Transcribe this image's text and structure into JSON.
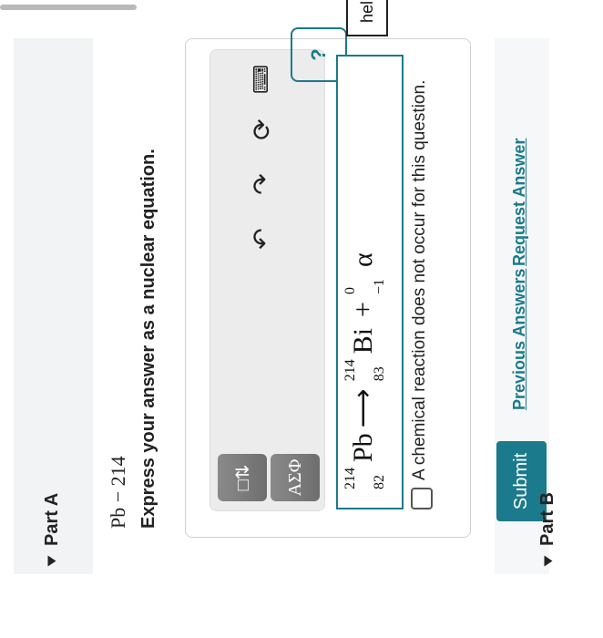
{
  "part_a": {
    "label": "Part A"
  },
  "part_b": {
    "label": "Part B"
  },
  "isotope": "Pb − 214",
  "prompt": "Express your answer as a nuclear equation.",
  "toolbar": {
    "templates_button": "□⇅",
    "symbols_button": "ΑΣΦ",
    "help_button": "?",
    "help_tag": "help"
  },
  "equation": {
    "reactant": {
      "mass": "214",
      "atomic": "82",
      "symbol": "Pb"
    },
    "arrow": "⟶",
    "product1": {
      "mass": "214",
      "atomic": "83",
      "symbol": "Bi"
    },
    "plus": "+",
    "product2": {
      "mass": "0",
      "atomic": "−1",
      "symbol": "α"
    }
  },
  "no_reaction_text": "A chemical reaction does not occur for this question.",
  "actions": {
    "submit": "Submit",
    "previous_answers": "Previous Answers",
    "request_answer": "Request Answer"
  }
}
